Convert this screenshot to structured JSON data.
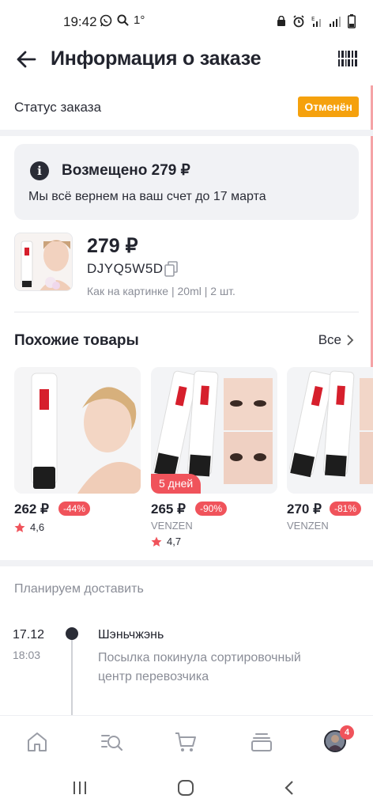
{
  "status_bar": {
    "time": "19:42",
    "extra": "1°"
  },
  "header": {
    "title": "Информация о заказе"
  },
  "order_status": {
    "label": "Статус заказа",
    "badge": "Отменён",
    "badge_color": "#f5a10d"
  },
  "refund": {
    "title": "Возмещено 279 ₽",
    "subtitle": "Мы всё вернем на ваш счет до 17 марта"
  },
  "product": {
    "price": "279 ₽",
    "code": "DJYQ5W5D",
    "variant": "Как на картинке | 20ml | 2 шт."
  },
  "similar": {
    "title": "Похожие товары",
    "see_all": "Все",
    "items": [
      {
        "price": "262 ₽",
        "discount": "-44%",
        "brand": "",
        "rating": "4,6",
        "tag": ""
      },
      {
        "price": "265 ₽",
        "discount": "-90%",
        "brand": "VENZEN",
        "rating": "4,7",
        "tag": "5 дней"
      },
      {
        "price": "270 ₽",
        "discount": "-81%",
        "brand": "VENZEN",
        "rating": "",
        "tag": ""
      }
    ]
  },
  "delivery": {
    "heading": "Планируем доставить",
    "events": [
      {
        "date": "17.12",
        "time": "18:03",
        "city": "Шэньчжэнь",
        "description": "Посылка покинула сортировочный центр перевозчика"
      }
    ]
  },
  "bottom_nav": {
    "items": [
      "home-icon",
      "catalog-search-icon",
      "cart-icon",
      "orders-icon",
      "profile-avatar"
    ],
    "profile_badge": "4"
  },
  "colors": {
    "accent": "#f0535b",
    "dark": "#22242e",
    "muted": "#8a8d97"
  }
}
